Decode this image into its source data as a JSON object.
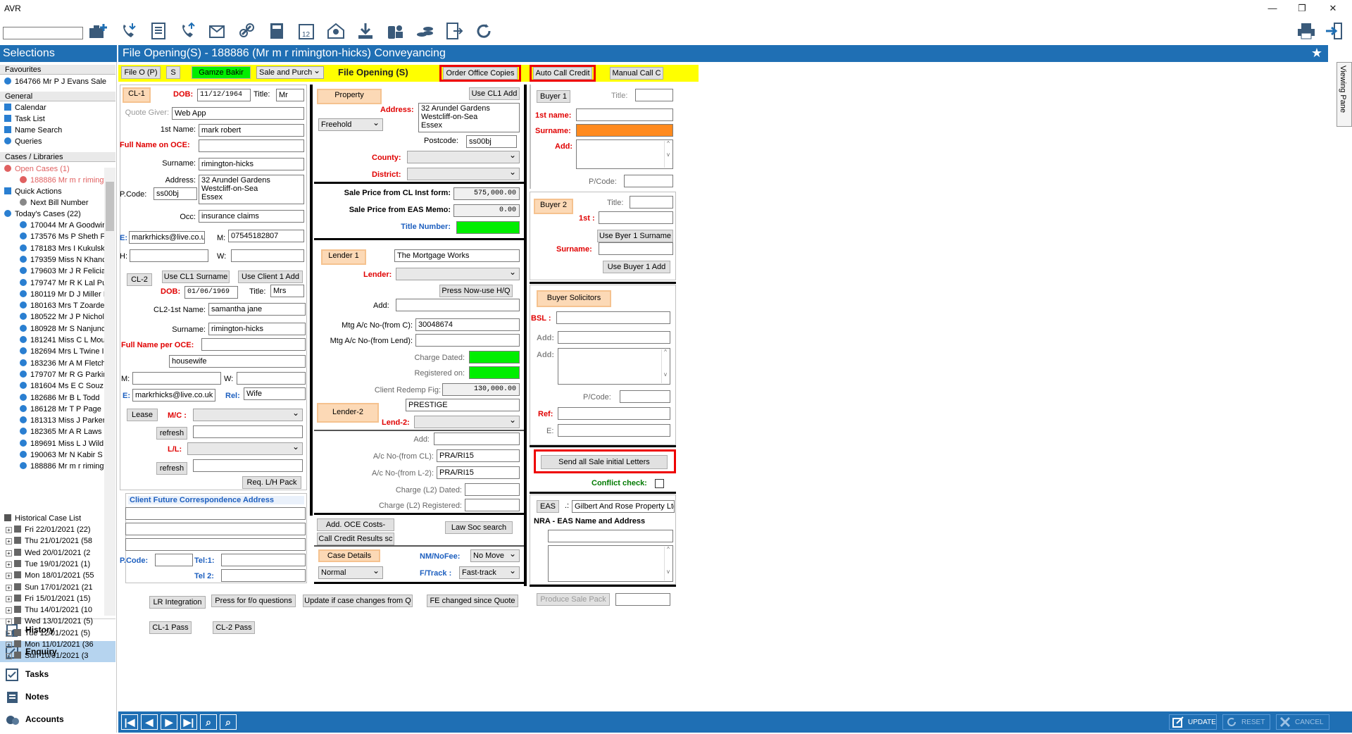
{
  "window": {
    "title": "AVR"
  },
  "toolbar": {
    "search_value": ""
  },
  "sidebar": {
    "title": "Selections",
    "sections": {
      "favourites": "Favourites",
      "general": "General",
      "cases": "Cases / Libraries"
    },
    "favourites": [
      "164766 Mr P J Evans Sale"
    ],
    "general": [
      "Calendar",
      "Task List",
      "Name Search",
      "Queries"
    ],
    "open_cases_label": "Open Cases  (1)",
    "open_case": "188886 Mr m r rimingto",
    "quick_actions": "Quick Actions",
    "next_bill": "Next Bill Number",
    "todays_cases": "Today's Cases  (22)",
    "today_items": [
      "170044 Mr A Goodwir",
      "173576 Ms P Sheth F",
      "178183 Mrs I Kukulsk",
      "179359 Miss N Khanc",
      "179603 Mr J R Felicia",
      "179747 Mr R K Lal Pu",
      "180119 Mr D J Miller I",
      "180163 Mrs T Zoarde",
      "180522 Mr J P Nichol",
      "180928 Mr S Nanjunc",
      "181241 Miss C L Mou",
      "182694 Mrs L Twine I",
      "183236 Mr A M Fletch",
      "179707 Mr R G Parkir",
      "181604 Ms E C Souz",
      "182686 Mr B L Todd",
      "186128 Mr T P Page",
      "181313 Miss J Parker",
      "182365 Mr A R Laws",
      "189691 Miss L J Wild",
      "190063 Mr N Kabir S",
      "188886 Mr m r rimingt"
    ],
    "historical": "Historical Case List",
    "history_items": [
      "Fri 22/01/2021  (22)",
      "Thu 21/01/2021  (58",
      "Wed 20/01/2021  (2",
      "Tue 19/01/2021  (1)",
      "Mon 18/01/2021  (55",
      "Sun 17/01/2021  (21",
      "Fri 15/01/2021  (15)",
      "Thu 14/01/2021  (10",
      "Wed 13/01/2021  (5)",
      "Tue 12/01/2021  (5)",
      "Mon 11/01/2021  (36",
      "Sun 10/01/2021  (3"
    ],
    "nav": [
      "History",
      "Enquiry",
      "Tasks",
      "Notes",
      "Accounts"
    ]
  },
  "header": {
    "title": "File Opening(S) - 188886 (Mr m r rimington-hicks) Conveyancing",
    "viewing_pane": "Viewing Pane"
  },
  "topbar": {
    "file_o": "File O (P)",
    "s": "S",
    "user": "Gamze Bakir",
    "sale_type": "Sale and Purch",
    "title": "File Opening (S)",
    "order_copies": "Order Office Copies",
    "auto_call": "Auto Call Credit",
    "manual_call": "Manual Call C"
  },
  "client": {
    "cl1_btn": "CL-1",
    "dob_label": "DOB:",
    "dob": "11/12/1964",
    "title_label": "Title:",
    "title": "Mr",
    "quote_giver_label": "Quote Giver:",
    "quote_giver": "Web App",
    "first_name_label": "1st Name:",
    "first_name": "mark robert",
    "full_name_oce_label": "Full Name on OCE:",
    "full_name_oce": "",
    "surname_label": "Surname:",
    "surname": "rimington-hicks",
    "address_label": "Address:",
    "address": "32 Arundel Gardens\nWestcliff-on-Sea\nEssex",
    "pcode_label": "P.Code:",
    "pcode": "ss00bj",
    "occ_label": "Occ:",
    "occ": "insurance claims",
    "e_label": "E:",
    "email": "markrhicks@live.co.u",
    "m_label": "M:",
    "mobile": "07545182807",
    "h_label": "H:",
    "home": "",
    "w_label": "W:",
    "work": "",
    "cl2_btn": "CL-2",
    "use_cl1_surname": "Use CL1 Surname",
    "use_client1_add": "Use Client 1 Add",
    "cl2_dob": "01/06/1969",
    "cl2_title": "Mrs",
    "cl2_first_label": "CL2-1st Name:",
    "cl2_first": "samantha jane",
    "cl2_surname": "rimington-hicks",
    "full_name_per_oce_label": "Full Name per OCE:",
    "cl2_full_name": "",
    "cl2_occ": "housewife",
    "cl2_m": "",
    "cl2_w": "",
    "cl2_email": "markrhicks@live.co.uk",
    "rel_label": "Rel:",
    "rel": "Wife",
    "lease_btn": "Lease",
    "mc_label": "M/C :",
    "refresh": "refresh",
    "ll_label": "L/L:",
    "req_lh_pack": "Req. L/H Pack",
    "future_corr": "Client Future Correspondence Address",
    "tel1_label": "Tel:1:",
    "tel2_label": "Tel 2:"
  },
  "property": {
    "btn": "Property",
    "use_cl1_add": "Use CL1 Add",
    "tenure": "Freehold",
    "address_label": "Address:",
    "address": "32 Arundel Gardens\nWestcliff-on-Sea\nEssex",
    "postcode_label": "Postcode:",
    "postcode": "ss00bj",
    "county_label": "County:",
    "district_label": "District:",
    "sale_price_cl_label": "Sale Price from CL Inst form:",
    "sale_price_cl": "575,000.00",
    "sale_price_eas_label": "Sale Price from EAS Memo:",
    "sale_price_eas": "0.00",
    "title_number_label": "Title Number:"
  },
  "lender": {
    "lender1_btn": "Lender 1",
    "lender1_name": "The Mortgage Works",
    "lender_label": "Lender:",
    "press_now": "Press Now-use H/Q",
    "add_label": "Add:",
    "mtg_ac_c_label": "Mtg  A/c No-(from C):",
    "mtg_ac_c": "30048674",
    "mtg_ac_lend_label": "Mtg A/c No-(from Lend):",
    "charge_dated_label": "Charge Dated:",
    "registered_label": "Registered on:",
    "redemp_label": "Client Redemp Fig:",
    "redemp": "130,000.00",
    "lender2_btn": "Lender-2",
    "lender2_name": "PRESTIGE",
    "lend2_label": "Lend-2:",
    "ac_cl_label": "A/c No-(from CL):",
    "ac_cl": "PRA/RI15",
    "ac_l2_label": "A/c No-(from L-2):",
    "ac_l2": "PRA/RI15",
    "charge_l2_label": "Charge (L2) Dated:",
    "charge_l2_reg_label": "Charge (L2) Registered:",
    "add_oce": "Add. OCE Costs-",
    "law_soc": "Law Soc search",
    "call_credit": "Call Credit Results sc",
    "case_details": "Case Details",
    "nm_label": "NM/NoFee:",
    "nm_value": "No Move",
    "normal": "Normal",
    "ftrack_label": "F/Track :",
    "ftrack_value": "Fast-track"
  },
  "buyer": {
    "buyer1_btn": "Buyer 1",
    "title_label": "Title:",
    "first_label": "1st name:",
    "surname_label": "Surname:",
    "add_label": "Add:",
    "pcode_label": "P/Code:",
    "buyer2_btn": "Buyer 2",
    "first2_label": "1st :",
    "use_byer1_surname": "Use Byer 1 Surname",
    "use_buyer1_add": "Use Buyer 1 Add",
    "solicitors_btn": "Buyer Solicitors",
    "bsl_label": "BSL :",
    "ref_label": "Ref:",
    "e_label": "E:",
    "send_letters": "Send all Sale initial Letters",
    "conflict_label": "Conflict check:",
    "eas_btn": "EAS",
    "eas_value": "Gilbert And Rose Property Ltd",
    "nra_label": "NRA - EAS Name and Address",
    "produce_pack": "Produce Sale Pack"
  },
  "bottom_buttons": {
    "lr_integration": "LR Integration",
    "press_fo": "Press for f/o questions",
    "update_if": "Update if case changes from Q",
    "fe_changed": "FE changed since Quote",
    "cl1_pass": "CL-1 Pass",
    "cl2_pass": "CL-2 Pass"
  },
  "footer": {
    "update": "UPDATE",
    "reset": "RESET",
    "cancel": "CANCEL"
  },
  "colors": {
    "accent": "#1f6fb4",
    "required": "#e00000",
    "highlight": "#ffff00",
    "green_field": "#00ee00"
  }
}
